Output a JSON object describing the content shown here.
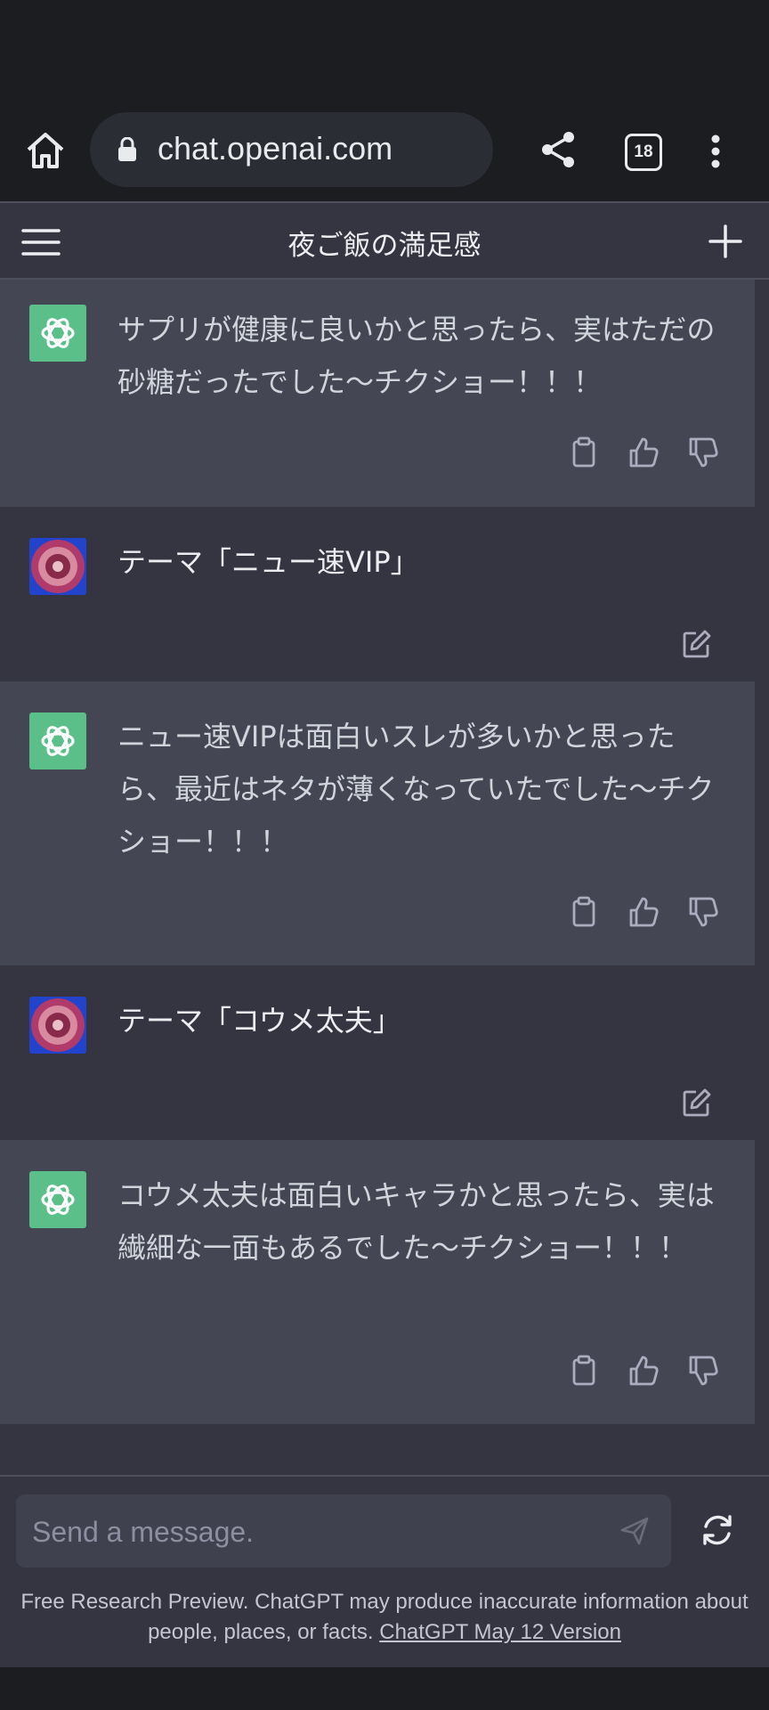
{
  "browser": {
    "url": "chat.openai.com",
    "tab_count": "18",
    "icons": [
      "home-icon",
      "lock-icon",
      "share-icon",
      "tabs-icon",
      "more-vert-icon"
    ]
  },
  "header": {
    "title": "夜ご飯の満足感",
    "icons": [
      "hamburger-menu-icon",
      "plus-icon"
    ]
  },
  "messages": [
    {
      "role": "assistant",
      "text": "サプリが健康に良いかと思ったら、実はただの砂糖だったでした〜チクショー！！！"
    },
    {
      "role": "user",
      "text": "テーマ「ニュー速VIP」"
    },
    {
      "role": "assistant",
      "text": "ニュー速VIPは面白いスレが多いかと思ったら、最近はネタが薄くなっていたでした〜チクショー！！！"
    },
    {
      "role": "user",
      "text": "テーマ「コウメ太夫」"
    },
    {
      "role": "assistant",
      "text": "コウメ太夫は面白いキャラかと思ったら、実は繊細な一面もあるでした〜チクショー！！！"
    }
  ],
  "composer": {
    "placeholder": "Send a message.",
    "icons": [
      "send-icon",
      "regenerate-icon"
    ]
  },
  "footer": {
    "disclaimer": "Free Research Preview. ChatGPT may produce inaccurate information about people, places, or facts.",
    "version_link": "ChatGPT May 12 Version"
  },
  "colors": {
    "background": "#343541",
    "assistant_bg": "#444654",
    "browser_bar": "#1c1d20",
    "gpt_avatar": "#5bbf8a"
  }
}
